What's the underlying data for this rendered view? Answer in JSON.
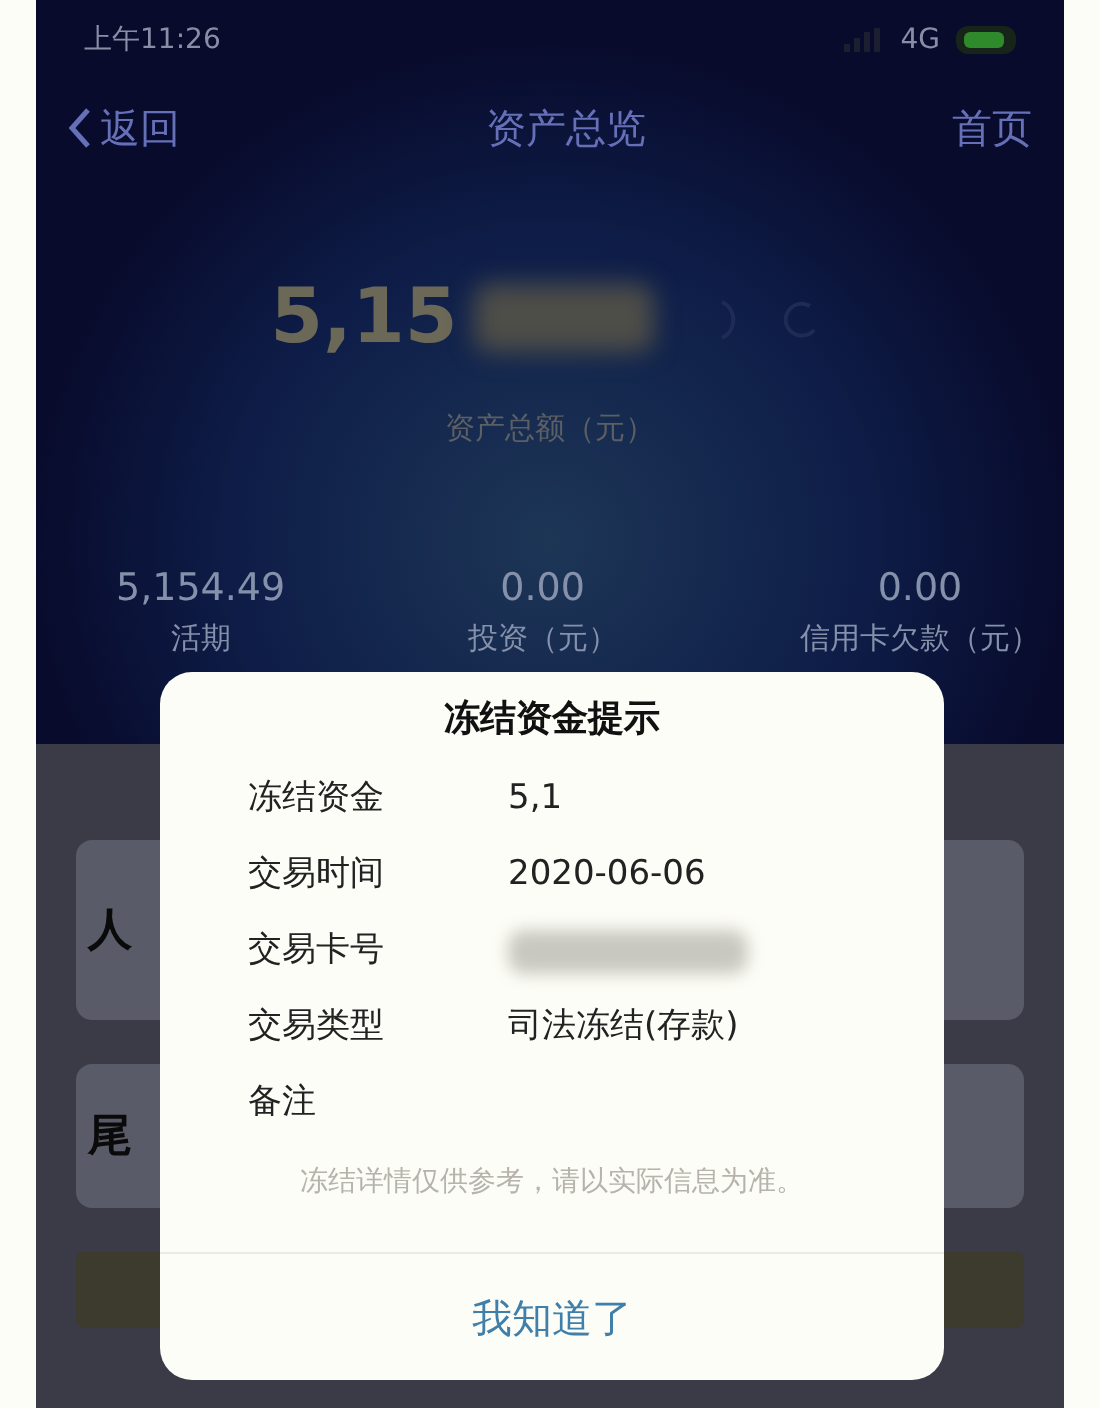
{
  "status_bar": {
    "time": "上午11:26",
    "network": "4G"
  },
  "nav": {
    "back": "返回",
    "title": "资产总览",
    "home": "首页"
  },
  "total": {
    "amount": "5,15",
    "label": "资产总额（元）"
  },
  "summary": [
    {
      "value": "5,154.49",
      "label": "活期"
    },
    {
      "value": "0.00",
      "label": "投资（元）"
    },
    {
      "value": "0.00",
      "label": "信用卡欠款（元）"
    }
  ],
  "background_rows": [
    {
      "text": "人"
    },
    {
      "text": "尾"
    }
  ],
  "dialog": {
    "title": "冻结资金提示",
    "fields": [
      {
        "label": "冻结资金",
        "value": "5,1"
      },
      {
        "label": "交易时间",
        "value": "2020-06-06"
      },
      {
        "label": "交易卡号",
        "redacted": true
      },
      {
        "label": "交易类型",
        "value": "司法冻结(存款)"
      },
      {
        "label": "备注"
      }
    ],
    "note": "冻结详情仅供参考，请以实际信息为准。",
    "button": "我知道了"
  }
}
